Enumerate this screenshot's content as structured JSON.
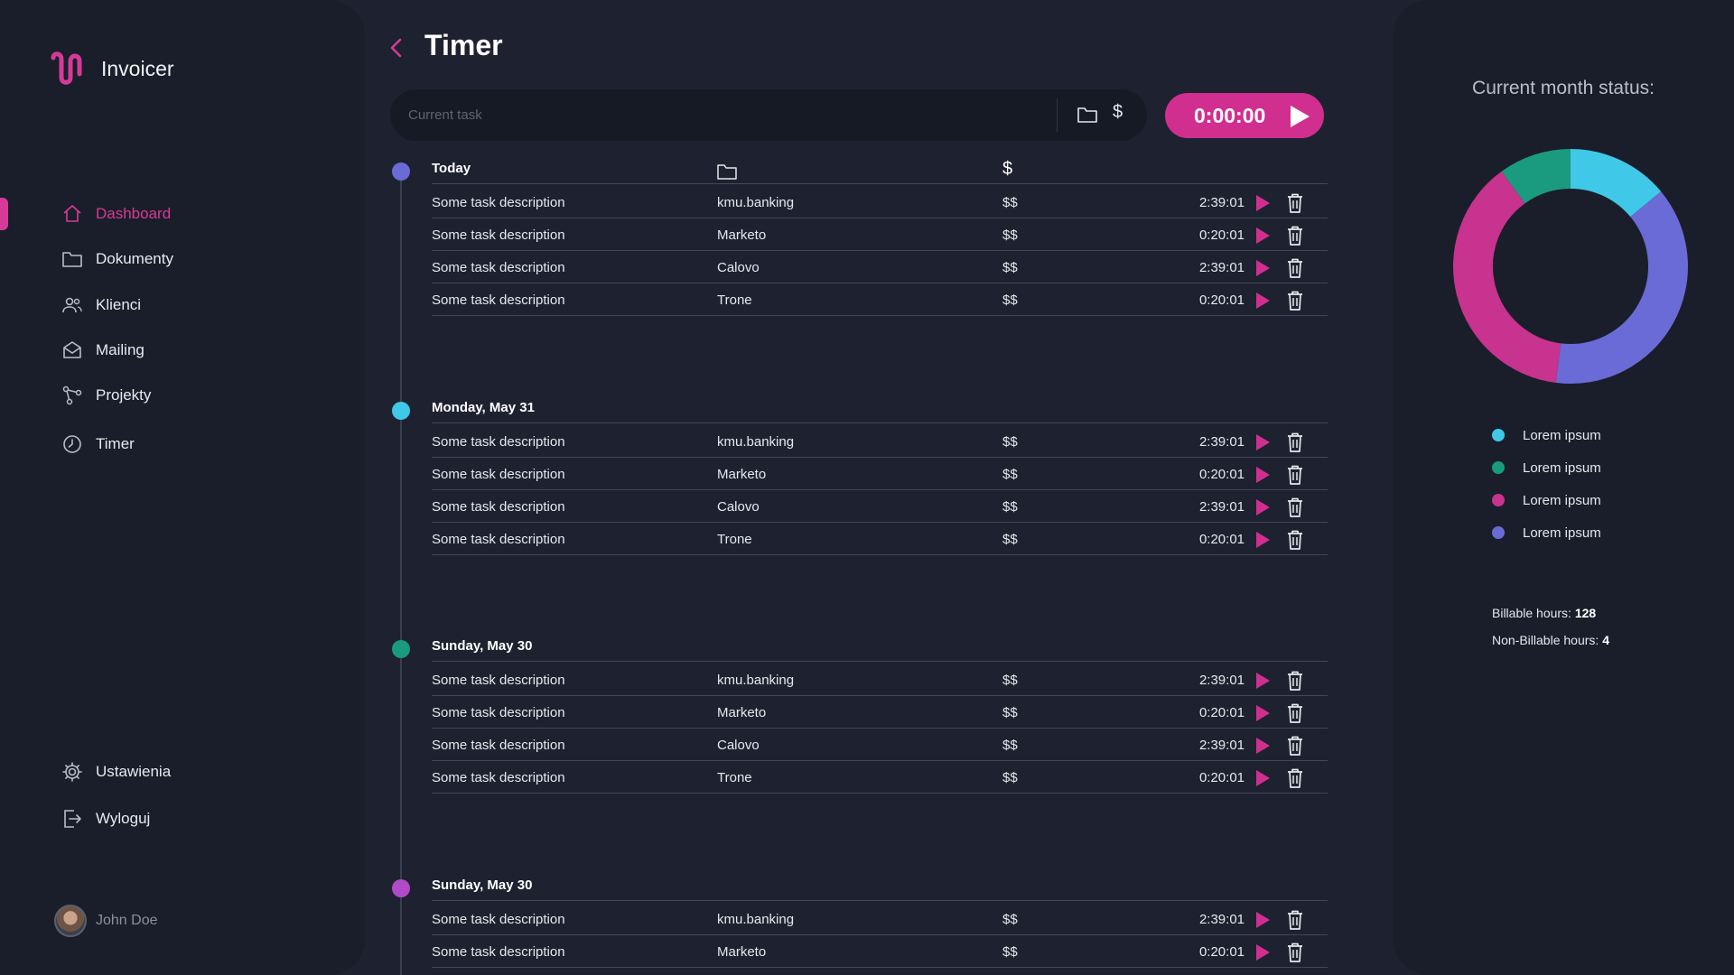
{
  "app": {
    "name": "Invoicer"
  },
  "sidebar": {
    "items": [
      {
        "label": "Dashboard",
        "icon": "home-icon",
        "active": true
      },
      {
        "label": "Dokumenty",
        "icon": "folder-icon",
        "active": false
      },
      {
        "label": "Klienci",
        "icon": "users-icon",
        "active": false
      },
      {
        "label": "Mailing",
        "icon": "mail-icon",
        "active": false
      },
      {
        "label": "Projekty",
        "icon": "project-icon",
        "active": false
      },
      {
        "label": "Timer",
        "icon": "clock-icon",
        "active": false
      }
    ],
    "bottom_items": [
      {
        "label": "Ustawienia",
        "icon": "gear-icon"
      },
      {
        "label": "Wyloguj",
        "icon": "logout-icon"
      }
    ],
    "user": {
      "name": "John Doe"
    }
  },
  "main": {
    "title": "Timer",
    "task_placeholder": "Current task",
    "billable_symbol": "$",
    "timer_value": "0:00:00",
    "groups": [
      {
        "title": "Today",
        "dot_color": "#6a6bd6",
        "head_dollar": "$",
        "rows": [
          {
            "desc": "Some task description",
            "project": "kmu.banking",
            "billable": "$$",
            "time": "2:39:01"
          },
          {
            "desc": "Some task description",
            "project": "Marketo",
            "billable": "$$",
            "time": "0:20:01"
          },
          {
            "desc": "Some task description",
            "project": "Calovo",
            "billable": "$$",
            "time": "2:39:01"
          },
          {
            "desc": "Some task description",
            "project": "Trone",
            "billable": "$$",
            "time": "0:20:01"
          }
        ]
      },
      {
        "title": "Monday, May 31",
        "dot_color": "#40c8e8",
        "head_dollar": "",
        "rows": [
          {
            "desc": "Some task description",
            "project": "kmu.banking",
            "billable": "$$",
            "time": "2:39:01"
          },
          {
            "desc": "Some task description",
            "project": "Marketo",
            "billable": "$$",
            "time": "0:20:01"
          },
          {
            "desc": "Some task description",
            "project": "Calovo",
            "billable": "$$",
            "time": "2:39:01"
          },
          {
            "desc": "Some task description",
            "project": "Trone",
            "billable": "$$",
            "time": "0:20:01"
          }
        ]
      },
      {
        "title": "Sunday, May 30",
        "dot_color": "#1a9a7e",
        "head_dollar": "",
        "rows": [
          {
            "desc": "Some task description",
            "project": "kmu.banking",
            "billable": "$$",
            "time": "2:39:01"
          },
          {
            "desc": "Some task description",
            "project": "Marketo",
            "billable": "$$",
            "time": "0:20:01"
          },
          {
            "desc": "Some task description",
            "project": "Calovo",
            "billable": "$$",
            "time": "2:39:01"
          },
          {
            "desc": "Some task description",
            "project": "Trone",
            "billable": "$$",
            "time": "0:20:01"
          }
        ]
      },
      {
        "title": "Sunday, May 30",
        "dot_color": "#b04ac8",
        "head_dollar": "",
        "rows": [
          {
            "desc": "Some task description",
            "project": "kmu.banking",
            "billable": "$$",
            "time": "2:39:01"
          },
          {
            "desc": "Some task description",
            "project": "Marketo",
            "billable": "$$",
            "time": "0:20:01"
          }
        ]
      }
    ]
  },
  "panel": {
    "title": "Current month status:",
    "chart": {
      "segments": [
        {
          "color": "#40c8e8",
          "value": 0.14
        },
        {
          "color": "#6a6bd6",
          "value": 0.38
        },
        {
          "color": "#c7338e",
          "value": 0.38
        },
        {
          "color": "#1a9a7e",
          "value": 0.1
        }
      ]
    },
    "legend": [
      {
        "label": "Lorem ipsum",
        "color": "#40c8e8"
      },
      {
        "label": "Lorem ipsum",
        "color": "#1a9a7e"
      },
      {
        "label": "Lorem ipsum",
        "color": "#c7338e"
      },
      {
        "label": "Lorem ipsum",
        "color": "#6a6bd6"
      }
    ],
    "billable_label": "Billable hours:",
    "billable_value": "128",
    "nonbillable_label": "Non-Billable hours:",
    "nonbillable_value": "4"
  },
  "colors": {
    "accent": "#d12f8f",
    "background": "#1e2230",
    "surface": "#1a1e2a"
  }
}
